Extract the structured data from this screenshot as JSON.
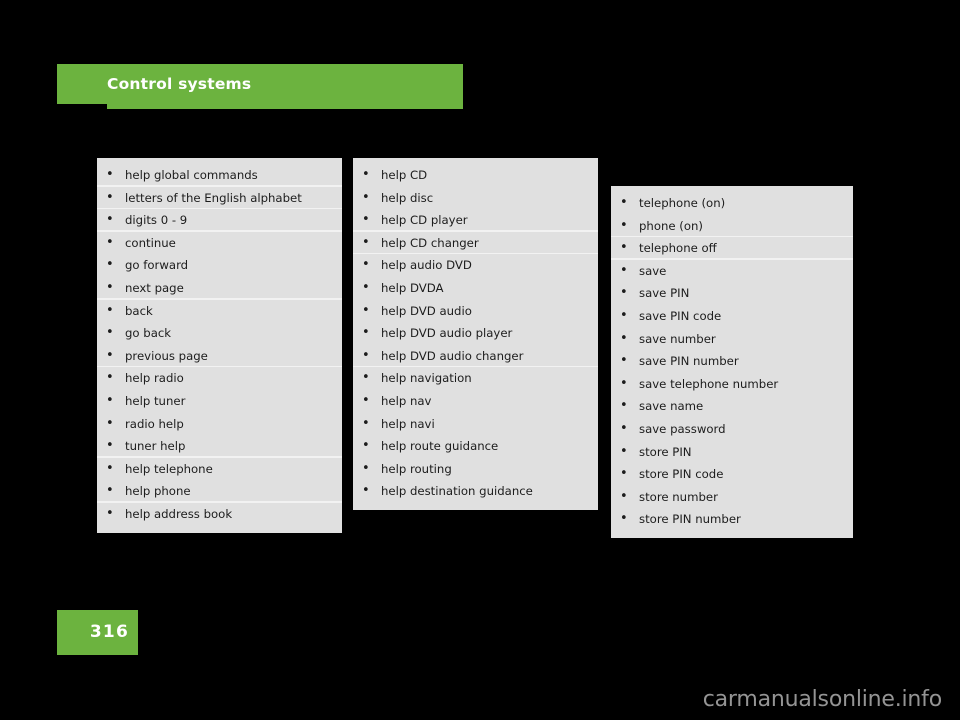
{
  "header": {
    "title": "Control systems",
    "accent_color": "#6cb33f"
  },
  "page": {
    "number": "316",
    "badge_color": "#6cb33f",
    "background_color": "#000000",
    "panel_color": "#e0e0e0",
    "separator_color": "#f2f2f2",
    "text_color": "#1c1c1c",
    "bullet_glyph": "•"
  },
  "columns": [
    {
      "id": "column-1",
      "items": [
        {
          "label": "help global commands",
          "separator_after": true
        },
        {
          "label": "letters of the English alphabet",
          "separator_after": true
        },
        {
          "label": "digits 0 - 9",
          "separator_after": true
        },
        {
          "label": "continue",
          "separator_after": false
        },
        {
          "label": "go forward",
          "separator_after": false
        },
        {
          "label": "next page",
          "separator_after": true
        },
        {
          "label": "back",
          "separator_after": false
        },
        {
          "label": "go back",
          "separator_after": false
        },
        {
          "label": "previous page",
          "separator_after": true
        },
        {
          "label": "help radio",
          "separator_after": false
        },
        {
          "label": "help tuner",
          "separator_after": false
        },
        {
          "label": "radio help",
          "separator_after": false
        },
        {
          "label": "tuner help",
          "separator_after": true
        },
        {
          "label": "help telephone",
          "separator_after": false
        },
        {
          "label": "help phone",
          "separator_after": true
        },
        {
          "label": "help address book",
          "separator_after": false
        }
      ]
    },
    {
      "id": "column-2",
      "items": [
        {
          "label": "help CD",
          "separator_after": false
        },
        {
          "label": "help disc",
          "separator_after": false
        },
        {
          "label": "help CD player",
          "separator_after": true
        },
        {
          "label": "help CD changer",
          "separator_after": true
        },
        {
          "label": "help audio DVD",
          "separator_after": false
        },
        {
          "label": "help DVDA",
          "separator_after": false
        },
        {
          "label": "help DVD audio",
          "separator_after": false
        },
        {
          "label": "help DVD audio player",
          "separator_after": false
        },
        {
          "label": "help DVD audio changer",
          "separator_after": true
        },
        {
          "label": "help navigation",
          "separator_after": false
        },
        {
          "label": "help nav",
          "separator_after": false
        },
        {
          "label": "help navi",
          "separator_after": false
        },
        {
          "label": "help route guidance",
          "separator_after": false
        },
        {
          "label": "help routing",
          "separator_after": false
        },
        {
          "label": "help destination guidance",
          "separator_after": false
        }
      ]
    },
    {
      "id": "column-3",
      "items": [
        {
          "label": "telephone (on)",
          "separator_after": false
        },
        {
          "label": "phone (on)",
          "separator_after": true
        },
        {
          "label": "telephone off",
          "separator_after": true
        },
        {
          "label": "save",
          "separator_after": false
        },
        {
          "label": "save PIN",
          "separator_after": false
        },
        {
          "label": "save PIN code",
          "separator_after": false
        },
        {
          "label": "save number",
          "separator_after": false
        },
        {
          "label": "save PIN number",
          "separator_after": false
        },
        {
          "label": "save telephone number",
          "separator_after": false
        },
        {
          "label": "save name",
          "separator_after": false
        },
        {
          "label": "save password",
          "separator_after": false
        },
        {
          "label": "store PIN",
          "separator_after": false
        },
        {
          "label": "store PIN code",
          "separator_after": false
        },
        {
          "label": "store number",
          "separator_after": false
        },
        {
          "label": "store PIN number",
          "separator_after": false
        }
      ]
    }
  ],
  "watermark": {
    "text": "carmanualsonline.info"
  }
}
